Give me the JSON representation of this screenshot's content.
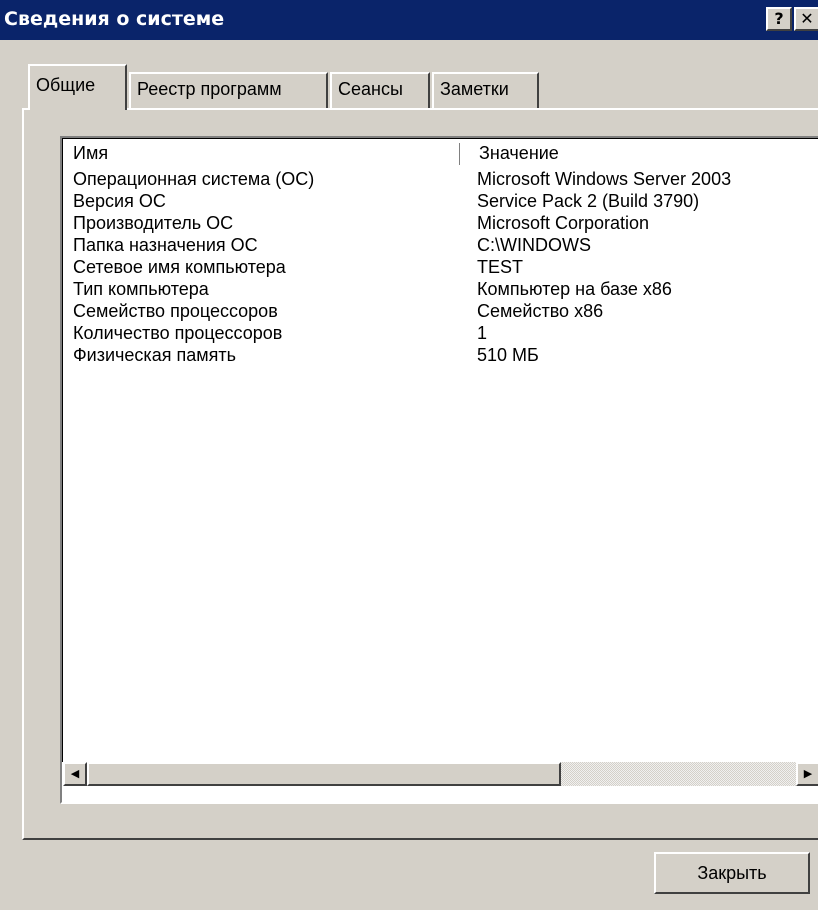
{
  "window": {
    "title": "Сведения о системе",
    "help_button": "?",
    "close_button": "✕"
  },
  "tabs": [
    {
      "label": "Общие",
      "active": true
    },
    {
      "label": "Реестр программ",
      "active": false
    },
    {
      "label": "Сеансы",
      "active": false
    },
    {
      "label": "Заметки",
      "active": false
    }
  ],
  "table": {
    "columns": [
      "Имя",
      "Значение"
    ],
    "rows": [
      {
        "name": "Операционная система (ОС)",
        "value": "Microsoft Windows Server 2003"
      },
      {
        "name": "Версия ОС",
        "value": "Service Pack 2 (Build 3790)"
      },
      {
        "name": "Производитель ОС",
        "value": "Microsoft Corporation"
      },
      {
        "name": "Папка назначения ОС",
        "value": "C:\\WINDOWS"
      },
      {
        "name": "Сетевое имя компьютера",
        "value": "TEST"
      },
      {
        "name": "Тип компьютера",
        "value": "Компьютер на базе x86"
      },
      {
        "name": "Семейство процессоров",
        "value": "Семейство x86"
      },
      {
        "name": "Количество процессоров",
        "value": "1"
      },
      {
        "name": "Физическая память",
        "value": "510 МБ"
      }
    ]
  },
  "scrollbar": {
    "left_arrow": "◀",
    "right_arrow": "▶"
  },
  "footer": {
    "close_label": "Закрыть"
  },
  "colors": {
    "titlebar": "#0a246a",
    "face": "#d4d0c8"
  }
}
